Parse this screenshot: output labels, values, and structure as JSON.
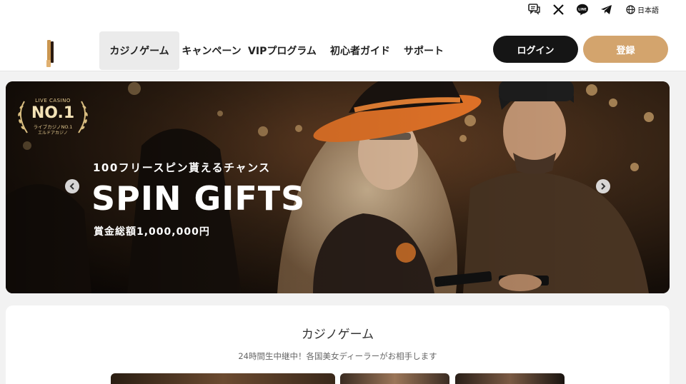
{
  "topbar": {
    "icons": [
      "chat-icon",
      "x-icon",
      "line-icon",
      "telegram-icon"
    ],
    "line_icon_text": "LINE",
    "language_label": "日本語"
  },
  "header": {
    "nav": [
      {
        "label": "カジノゲーム",
        "active": true
      },
      {
        "label": "キャンペーン",
        "active": false
      },
      {
        "label": "VIPプログラム",
        "active": false
      },
      {
        "label": "初心者ガイド",
        "active": false
      },
      {
        "label": "サポート",
        "active": false
      }
    ],
    "login_label": "ログイン",
    "register_label": "登録"
  },
  "hero": {
    "badge": {
      "top": "LIVE CASINO",
      "rank": "NO.1",
      "line1": "ライブカジノNO.1",
      "line2": "エルドアカジノ"
    },
    "pretitle": "100フリースピン貰えるチャンス",
    "title": "SPIN GIFTS",
    "subtitle": "賞金総額1,000,000円"
  },
  "section": {
    "title": "カジノゲーム",
    "subtitle": "24時間生中継中！各国美女ディーラーがお相手します"
  },
  "colors": {
    "brand_gold": "#d3a46d",
    "login_dark": "#151515",
    "nav_active_bg": "#ebebeb"
  }
}
